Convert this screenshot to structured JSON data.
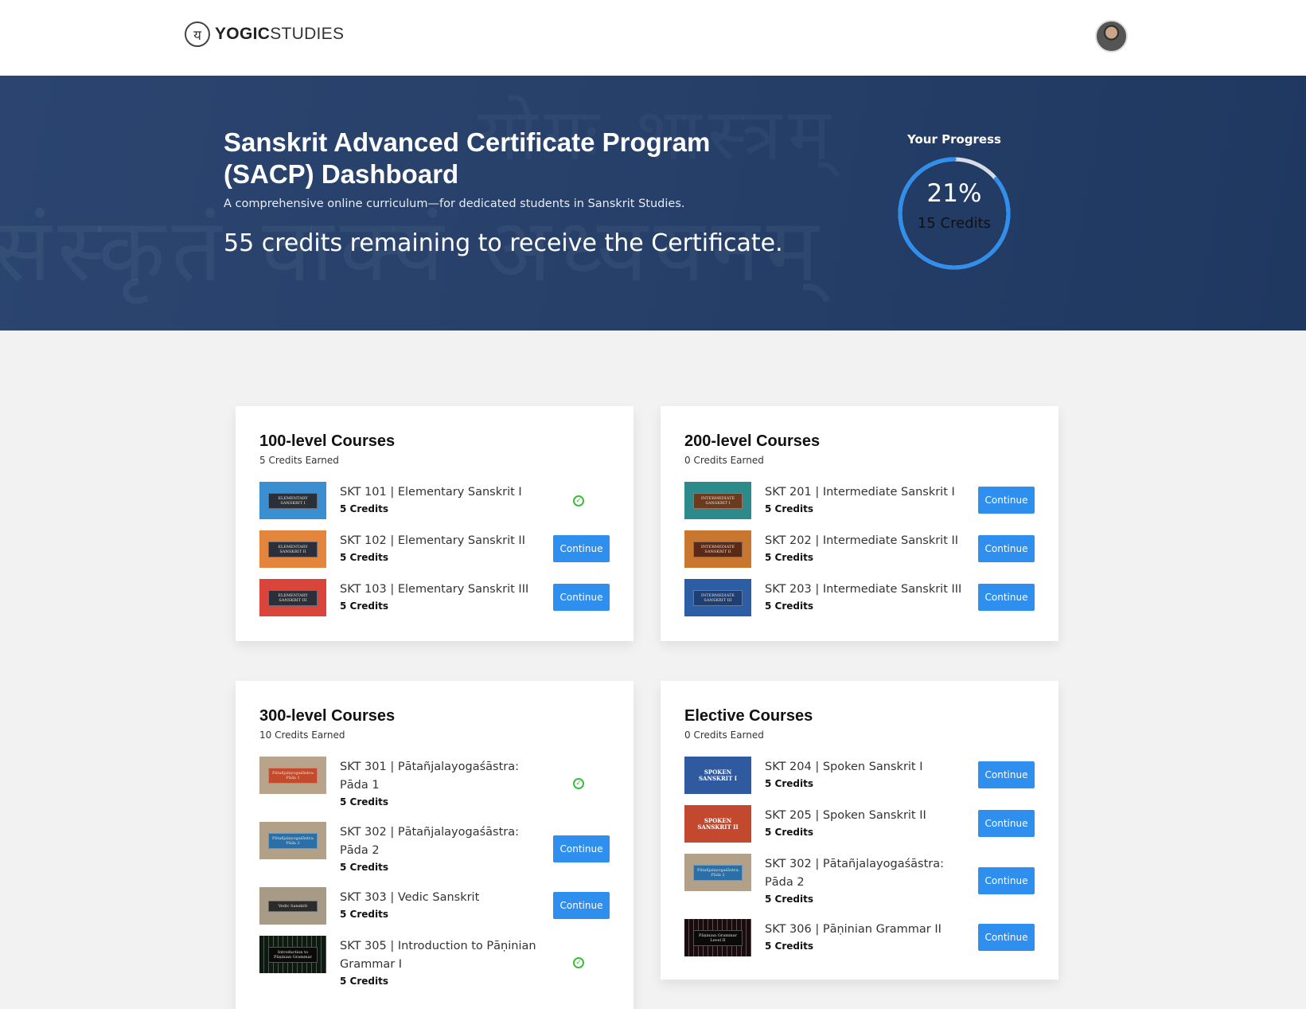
{
  "header": {
    "logo_glyph": "य",
    "logo_bold": "YOGIC",
    "logo_light": "STUDIES"
  },
  "hero": {
    "title": "Sanskrit Advanced Certificate Program (SACP) Dashboard",
    "subtitle": "A comprehensive online curriculum—for dedicated students in Sanskrit Studies.",
    "remaining": "55 credits remaining to receive the Certificate.",
    "progress_label": "Your Progress",
    "progress_percent": "21%",
    "progress_value": 0.21,
    "progress_credits": "15 Credits"
  },
  "levels": {
    "l100": {
      "title": "100-level Courses",
      "earned": "5 Credits Earned",
      "courses": [
        {
          "name": "SKT 101 | Elementary Sanskrit I",
          "credits": "5 Credits",
          "status": "complete",
          "thumb_text": "ELEMENTARY SANSKRIT I",
          "thumb_color": "#3a8fd0"
        },
        {
          "name": "SKT 102 | Elementary Sanskrit II",
          "credits": "5 Credits",
          "action": "Continue",
          "thumb_text": "ELEMENTARY SANSKRIT II",
          "thumb_color": "#e3853d"
        },
        {
          "name": "SKT 103 | Elementary Sanskrit III",
          "credits": "5 Credits",
          "action": "Continue",
          "thumb_text": "ELEMENTARY SANSKRIT III",
          "thumb_color": "#d9443b"
        }
      ]
    },
    "l200": {
      "title": "200-level Courses",
      "earned": "0 Credits Earned",
      "courses": [
        {
          "name": "SKT 201 | Intermediate Sanskrit I",
          "credits": "5 Credits",
          "action": "Continue",
          "thumb_text": "INTERMEDIATE SANSKRIT I",
          "thumb_color": "#2c8a8a"
        },
        {
          "name": "SKT 202 | Intermediate Sanskrit II",
          "credits": "5 Credits",
          "action": "Continue",
          "thumb_text": "INTERMEDIATE SANSKRIT II",
          "thumb_color": "#c9772f"
        },
        {
          "name": "SKT 203 | Intermediate Sanskrit III",
          "credits": "5 Credits",
          "action": "Continue",
          "thumb_text": "INTERMEDIATE SANSKRIT III",
          "thumb_color": "#2d5da4"
        }
      ]
    },
    "l300": {
      "title": "300-level Courses",
      "earned": "10 Credits Earned",
      "courses": [
        {
          "name": "SKT 301 | Pātañjalayogaśāstra: Pāda 1",
          "credits": "5 Credits",
          "status": "complete",
          "thumb_text": "Pātañjalayogaśāstra: Pāda 1",
          "thumb_color": "#b8a48a"
        },
        {
          "name": "SKT 302 | Pātañjalayogaśāstra: Pāda 2",
          "credits": "5 Credits",
          "action": "Continue",
          "thumb_text": "Pātañjalayogaśāstra: Pāda 2",
          "thumb_color": "#b3a088"
        },
        {
          "name": "SKT 303 | Vedic Sanskrit",
          "credits": "5 Credits",
          "action": "Continue",
          "thumb_text": "Vedic Sanskrit",
          "thumb_color": "#a79a86"
        },
        {
          "name": "SKT 305 | Introduction to Pāṇinian Grammar I",
          "credits": "5 Credits",
          "status": "complete",
          "thumb_text": "Introduction to Pāṇinian Grammar",
          "thumb_color": "#0e1a10"
        }
      ]
    },
    "elective": {
      "title": "Elective Courses",
      "earned": "0 Credits Earned",
      "courses": [
        {
          "name": "SKT 204 | Spoken Sanskrit I",
          "credits": "5 Credits",
          "action": "Continue",
          "thumb_text": "SPOKEN SANSKRIT I",
          "thumb_color": "#2f5aa0"
        },
        {
          "name": "SKT 205 | Spoken Sanskrit II",
          "credits": "5 Credits",
          "action": "Continue",
          "thumb_text": "SPOKEN SANSKRIT II",
          "thumb_color": "#c2492e"
        },
        {
          "name": "SKT 302 | Pātañjalayogaśāstra: Pāda 2",
          "credits": "5 Credits",
          "action": "Continue",
          "thumb_text": "Pātañjalayogaśāstra: Pāda 2",
          "thumb_color": "#b3a088"
        },
        {
          "name": "SKT 306 | Pāṇinian Grammar II",
          "credits": "5 Credits",
          "action": "Continue",
          "thumb_text": "Pāṇinian Grammar Level II",
          "thumb_color": "#1a0c0e"
        }
      ]
    }
  },
  "colors": {
    "accent": "#2f8fef",
    "check": "#3dbb3d",
    "hero_bg": "#27416b"
  },
  "icons": {
    "complete": "check-circle-icon"
  }
}
